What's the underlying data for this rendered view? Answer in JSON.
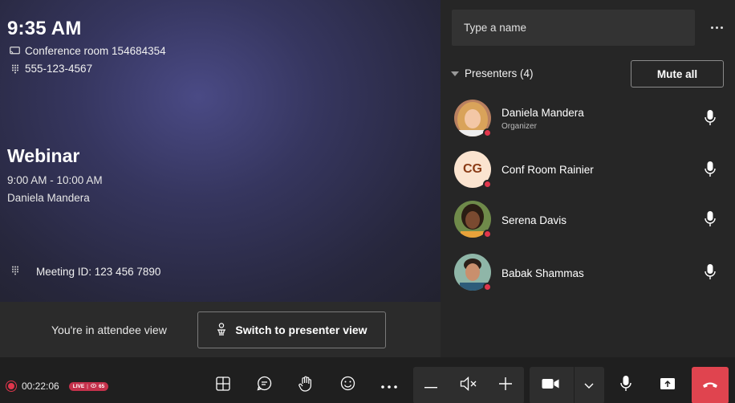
{
  "stage": {
    "clock": "9:35 AM",
    "room": "Conference room 154684354",
    "phone": "555-123-4567",
    "webinar_title": "Webinar",
    "webinar_time": "9:00 AM - 10:00 AM",
    "webinar_organizer": "Daniela Mandera",
    "meeting_id": "Meeting ID: 123 456 7890"
  },
  "attendee_bar": {
    "text": "You're in attendee view",
    "switch_label": "Switch to presenter view"
  },
  "panel": {
    "name_placeholder": "Type a name",
    "presenters_label": "Presenters (4)",
    "mute_all_label": "Mute all",
    "people": [
      {
        "name": "Daniela Mandera",
        "role": "Organizer",
        "avatar": "photo",
        "presence": "busy"
      },
      {
        "name": "Conf Room Rainier",
        "role": "",
        "avatar": "initials",
        "initials": "CG",
        "presence": "busy"
      },
      {
        "name": "Serena Davis",
        "role": "",
        "avatar": "photo",
        "presence": "busy"
      },
      {
        "name": "Babak Shammas",
        "role": "",
        "avatar": "photo",
        "presence": "busy"
      }
    ]
  },
  "toolbar": {
    "recording_time": "00:22:06",
    "live_label": "LIVE",
    "viewer_count": "65",
    "icons": [
      "layout-icon",
      "chat-icon",
      "raise-hand-icon",
      "reactions-icon",
      "more-icon",
      "volume-down-icon",
      "speaker-mute-icon",
      "volume-up-icon",
      "camera-icon",
      "chevron-down-icon",
      "mic-icon",
      "share-screen-icon",
      "hang-up-icon"
    ],
    "colors": {
      "end_call": "#e0444f",
      "live": "#c4314b",
      "presence_busy": "#e0364c"
    }
  }
}
